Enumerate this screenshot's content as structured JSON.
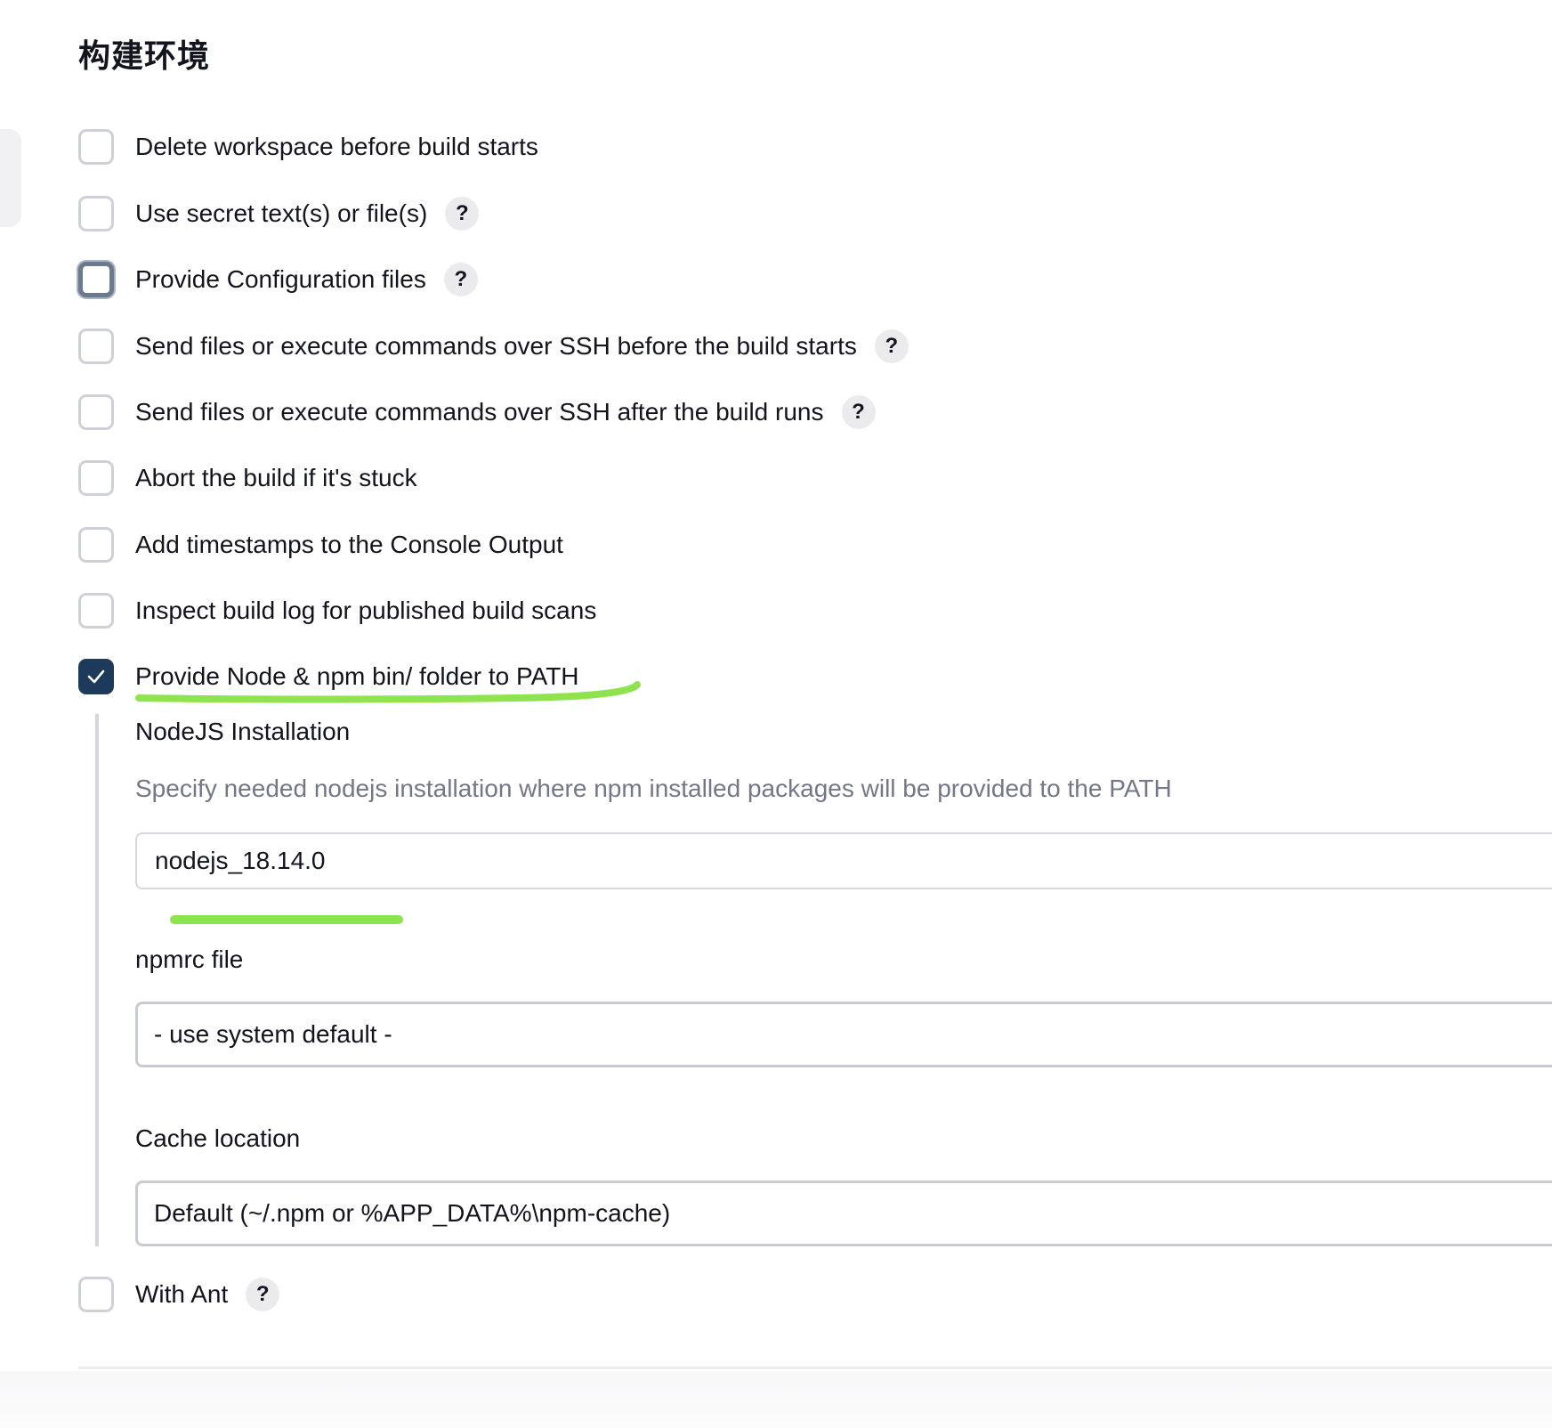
{
  "section": {
    "title": "构建环境"
  },
  "options": [
    {
      "label": "Delete workspace before build starts",
      "checked": false,
      "help": ""
    },
    {
      "label": "Use secret text(s) or file(s)",
      "checked": false,
      "help": "?"
    },
    {
      "label": "Provide Configuration files",
      "checked": false,
      "focused": true,
      "help": "?"
    },
    {
      "label": "Send files or execute commands over SSH before the build starts",
      "checked": false,
      "help": "?"
    },
    {
      "label": "Send files or execute commands over SSH after the build runs",
      "checked": false,
      "help": "?"
    },
    {
      "label": "Abort the build if it's stuck",
      "checked": false,
      "help": ""
    },
    {
      "label": "Add timestamps to the Console Output",
      "checked": false,
      "help": ""
    },
    {
      "label": "Inspect build log for published build scans",
      "checked": false,
      "help": ""
    },
    {
      "label": "Provide Node & npm bin/ folder to PATH",
      "checked": true,
      "help": ""
    },
    {
      "label": "With Ant",
      "checked": false,
      "help": "?"
    }
  ],
  "node_config": {
    "installation_label": "NodeJS Installation",
    "installation_desc": "Specify needed nodejs installation where npm installed packages will be provided to the PATH",
    "installation_value": "nodejs_18.14.0",
    "npmrc_label": "npmrc file",
    "npmrc_value": "- use system default -",
    "cache_label": "Cache location",
    "cache_value": "Default (~/.npm or %APP_DATA%\\npm-cache)"
  },
  "colors": {
    "checked_box": "#1e3a5a",
    "highlight_marker": "#8fe34f",
    "description_text": "#757687"
  }
}
